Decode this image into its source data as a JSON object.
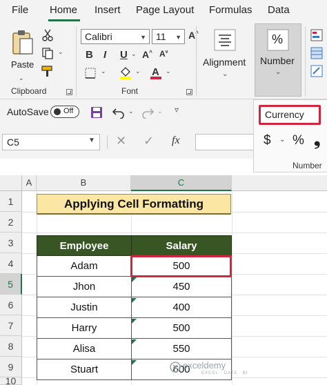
{
  "menu": {
    "tabs": [
      {
        "label": "File"
      },
      {
        "label": "Home"
      },
      {
        "label": "Insert"
      },
      {
        "label": "Page Layout"
      },
      {
        "label": "Formulas"
      },
      {
        "label": "Data"
      }
    ],
    "active_tab": "Home"
  },
  "ribbon": {
    "clipboard": {
      "paste_label": "Paste",
      "group_label": "Clipboard"
    },
    "font": {
      "name": "Calibri",
      "size": "11",
      "group_label": "Font",
      "highlight_color": "#ffff00",
      "font_color": "#d0243f"
    },
    "alignment": {
      "label": "Alignment"
    },
    "number": {
      "label": "Number",
      "symbol": "%",
      "group_label": "Number",
      "format_value": "Currency",
      "currency_symbol": "$",
      "percent_symbol": "%",
      "comma_symbol": "❟"
    }
  },
  "quick_access": {
    "autosave_label": "AutoSave",
    "toggle_state": "Off"
  },
  "formula_bar": {
    "name_box": "C5",
    "fx_label": "fx",
    "formula": ""
  },
  "sheet": {
    "columns": [
      "A",
      "B",
      "C"
    ],
    "selected_column": "C",
    "rows": [
      "1",
      "2",
      "3",
      "4",
      "5",
      "6",
      "7",
      "8",
      "9",
      "10"
    ],
    "selected_row": "5",
    "title": "Applying Cell Formatting",
    "headers": [
      "Employee",
      "Salary"
    ],
    "data": [
      {
        "employee": "Adam",
        "salary": "500"
      },
      {
        "employee": "Jhon",
        "salary": "450"
      },
      {
        "employee": "Justin",
        "salary": "400"
      },
      {
        "employee": "Harry",
        "salary": "500"
      },
      {
        "employee": "Alisa",
        "salary": "550"
      },
      {
        "employee": "Stuart",
        "salary": "600"
      }
    ]
  },
  "colors": {
    "accent": "#217346",
    "header_fill": "#375623",
    "title_fill": "#fbe6a4",
    "highlight_border": "#d0243f"
  },
  "watermark": {
    "brand": "exceldemy",
    "tagline": "EXCEL · DATA · BI"
  }
}
